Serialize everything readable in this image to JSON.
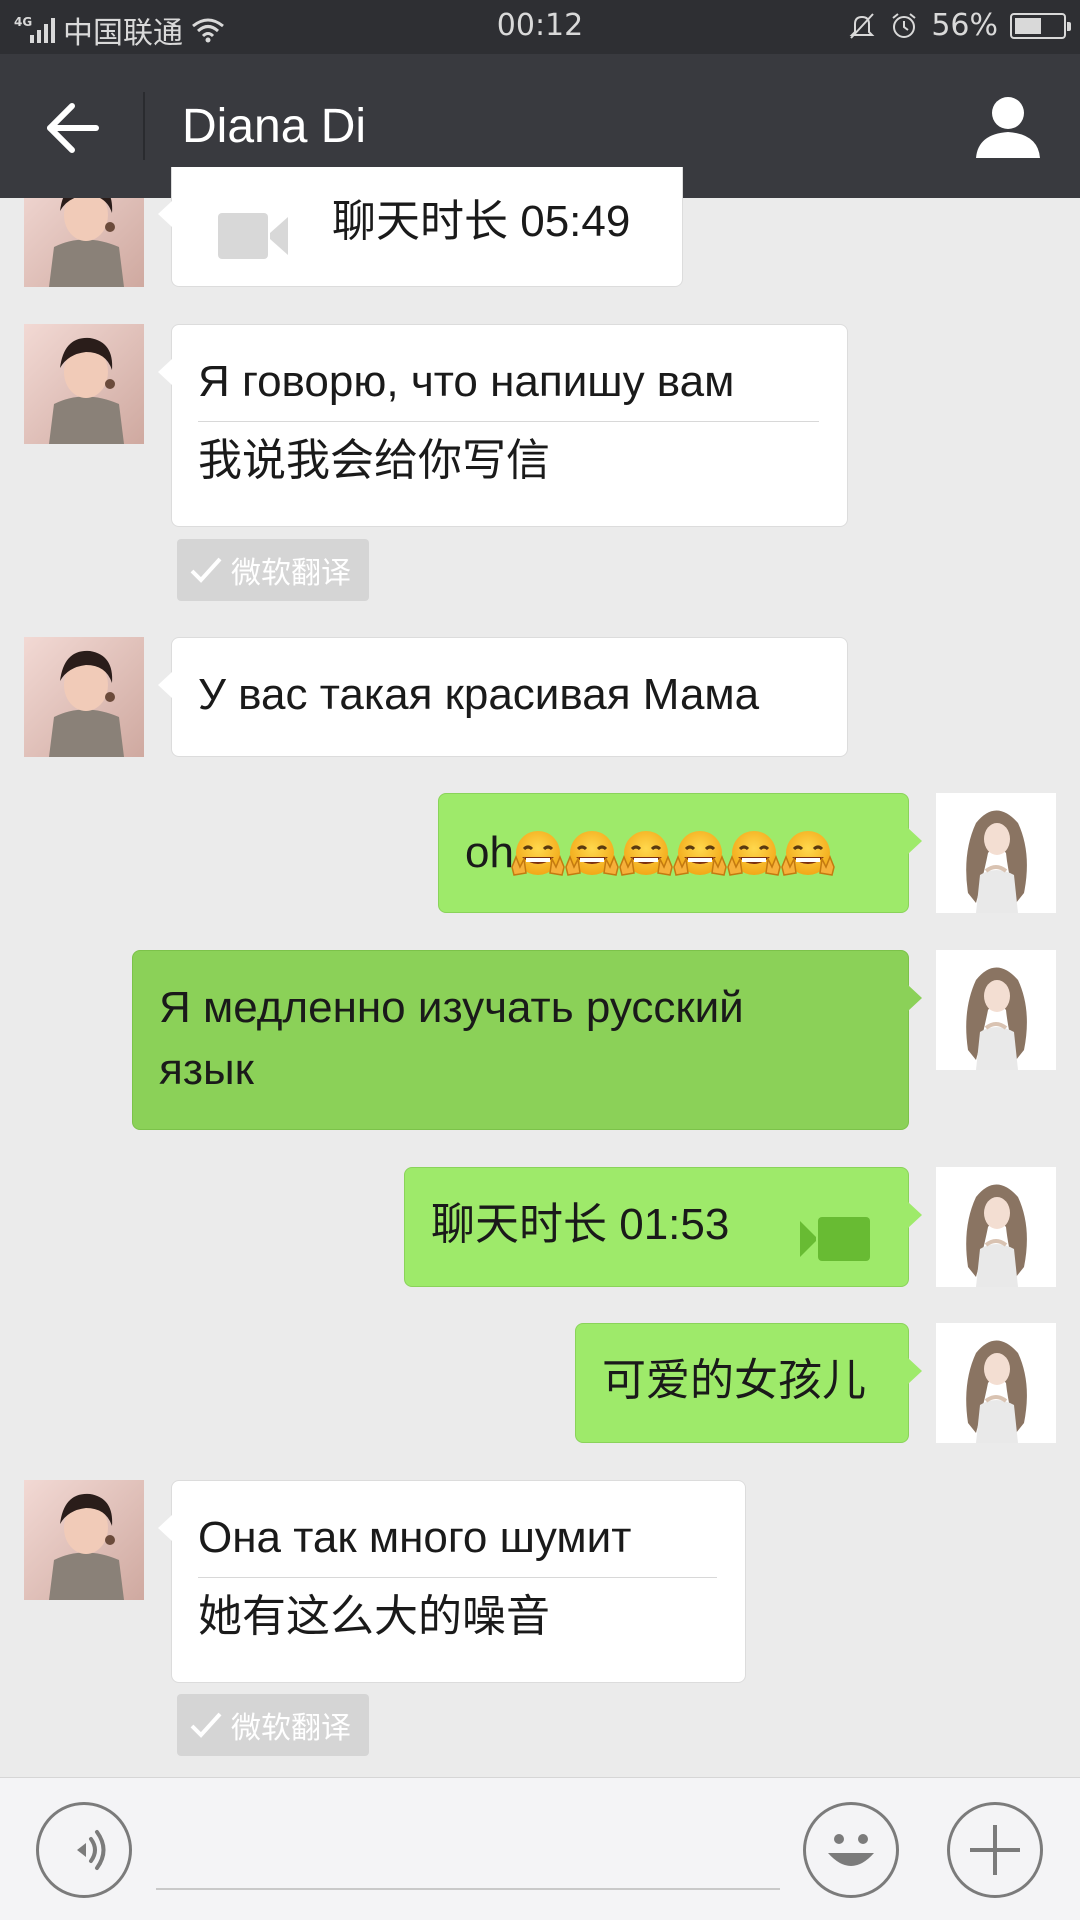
{
  "status_bar": {
    "network": "4G",
    "carrier": "中国联通",
    "time": "00:12",
    "battery_percent_label": "56%",
    "battery_level": 0.56
  },
  "nav": {
    "title": "Diana Di"
  },
  "messages": [
    {
      "direction": "in",
      "type": "video_call",
      "text": "聊天时长 05:49"
    },
    {
      "direction": "in",
      "type": "text",
      "text": "Я говорю, что напишу вам",
      "translation": "我说我会给你写信",
      "translation_badge": "微软翻译"
    },
    {
      "direction": "in",
      "type": "text",
      "text": "У вас такая красивая Мама"
    },
    {
      "direction": "out",
      "type": "text",
      "text": "oh",
      "emoji": "grinning-face-with-peace-sign",
      "emoji_count": 6
    },
    {
      "direction": "out",
      "type": "text",
      "text": "Я медленно изучать русский язык"
    },
    {
      "direction": "out",
      "type": "video_call",
      "text": "聊天时长 01:53"
    },
    {
      "direction": "out",
      "type": "text",
      "text": "可爱的女孩儿"
    },
    {
      "direction": "in",
      "type": "text",
      "text": "Она так много шумит",
      "translation": "她有这么大的噪音",
      "translation_badge": "微软翻译"
    }
  ],
  "input_bar": {
    "placeholder": "",
    "icons": [
      "voice-icon",
      "emoji-face-icon",
      "plus-icon"
    ]
  },
  "colors": {
    "status_bar": "#2e2f33",
    "nav_bar": "#393a3f",
    "chat_background": "#ebebeb",
    "outgoing_bubble": "#9eea6a",
    "incoming_bubble": "#ffffff"
  }
}
